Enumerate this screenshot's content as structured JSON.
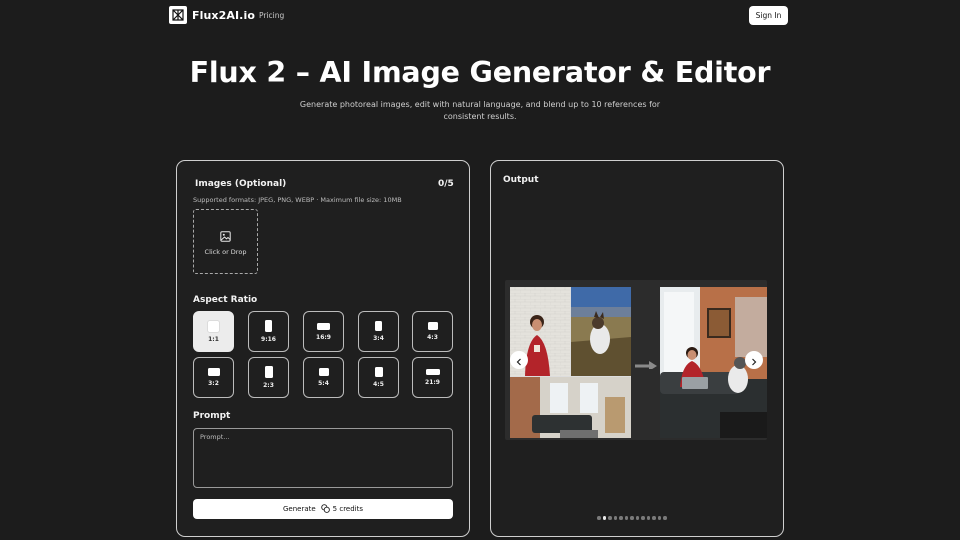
{
  "nav": {
    "brand": "Flux2AI.io",
    "links": [
      "Pricing"
    ],
    "signin_label": "Sign In"
  },
  "hero": {
    "title": "Flux 2 – AI Image Generator & Editor",
    "subtitle": "Generate photoreal images, edit with natural language, and blend up to 10 references for consistent results."
  },
  "left_panel": {
    "images_title": "Images (Optional)",
    "images_count": "0/5",
    "formats_note": "Supported formats: JPEG, PNG, WEBP · Maximum file size: 10MB",
    "dropzone_label": "Click or Drop",
    "aspect_title": "Aspect Ratio",
    "aspect_ratios": [
      "1:1",
      "9:16",
      "16:9",
      "3:4",
      "4:3",
      "3:2",
      "2:3",
      "5:4",
      "4:5",
      "21:9"
    ],
    "selected_ratio": "1:1",
    "prompt_title": "Prompt",
    "prompt_placeholder": "Prompt...",
    "prompt_value": "",
    "generate_label": "Generate",
    "credits_label": "5 credits"
  },
  "right_panel": {
    "output_title": "Output",
    "carousel": {
      "slide_count": 13,
      "active_index": 1
    }
  },
  "colors": {
    "background": "#1c1c1c",
    "panel_border": "#cfcfcf",
    "button_light": "#ffffff"
  }
}
